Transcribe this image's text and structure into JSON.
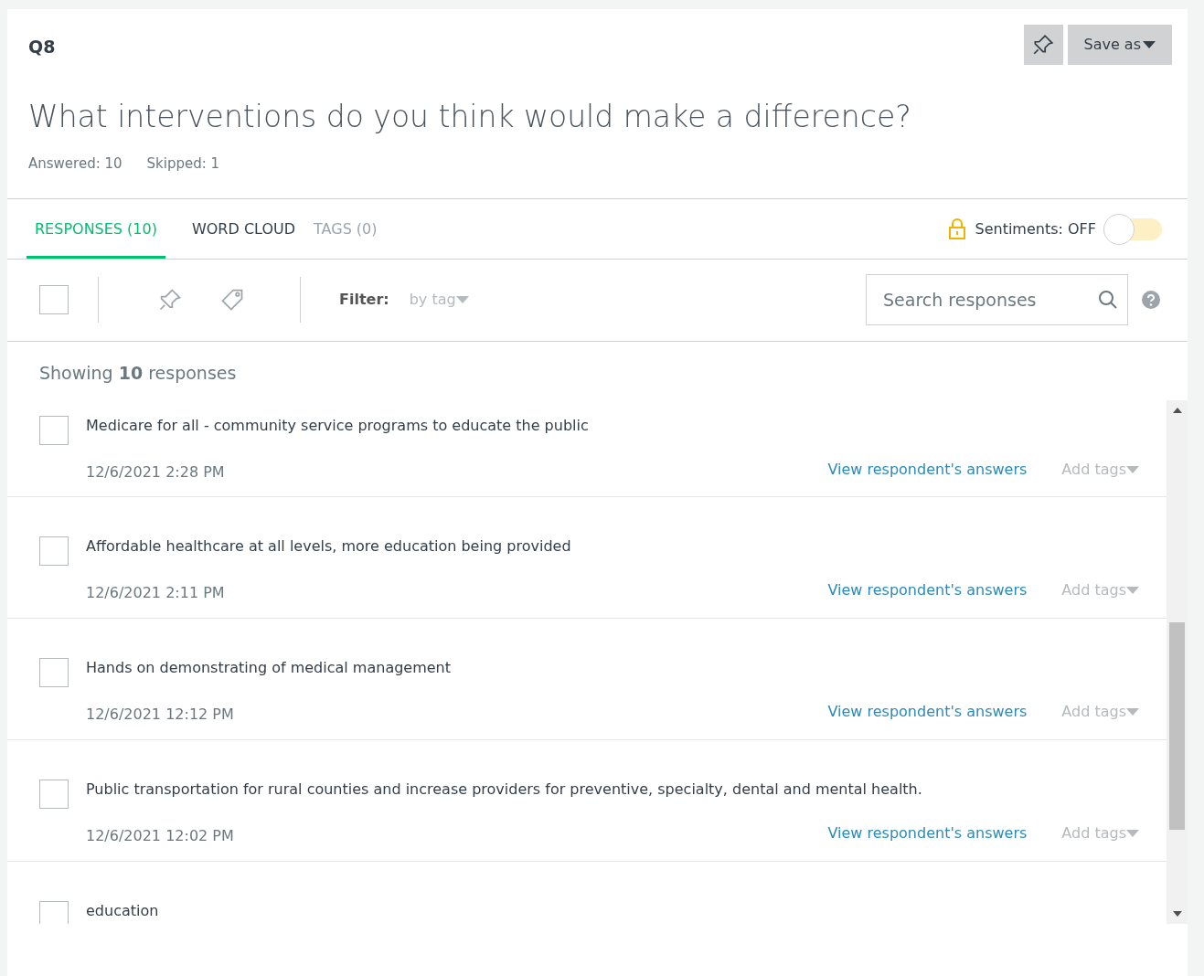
{
  "header": {
    "question_number": "Q8",
    "save_button": "Save as"
  },
  "question": {
    "title": "What interventions do you think would make a difference?",
    "answered": "Answered: 10",
    "skipped": "Skipped: 1"
  },
  "tabs": [
    {
      "label": "RESPONSES (10)",
      "selected": true,
      "disabled": false
    },
    {
      "label": "WORD CLOUD",
      "selected": false,
      "disabled": false
    },
    {
      "label": "TAGS (0)",
      "selected": false,
      "disabled": true
    }
  ],
  "sentiments": {
    "label": "Sentiments: OFF",
    "on": false
  },
  "toolbar": {
    "select_all_checked": false,
    "filter_label": "Filter:",
    "filter_value": "by tag",
    "search": {
      "placeholder": "Search responses"
    }
  },
  "summary": "Showing **10** responses",
  "responses": [
    {
      "text": "Medicare for all - community service programs to educate the public",
      "date": "12/6/2021 2:28 PM",
      "link": "View respondent's answers",
      "tags": "Add tags",
      "checked": false
    },
    {
      "text": "Affordable healthcare at all levels, more education being provided",
      "date": "12/6/2021 2:11 PM",
      "link": "View respondent's answers",
      "tags": "Add tags",
      "checked": false
    },
    {
      "text": "Hands on demonstrating of medical management",
      "date": "12/6/2021 12:12 PM",
      "link": "View respondent's answers",
      "tags": "Add tags",
      "checked": false
    },
    {
      "text": "Public transportation for rural counties and increase providers for preventive, specialty, dental and mental health.",
      "date": "12/6/2021 12:02 PM",
      "link": "View respondent's answers",
      "tags": "Add tags",
      "checked": false
    },
    {
      "text": "education",
      "checked": false
    }
  ]
}
